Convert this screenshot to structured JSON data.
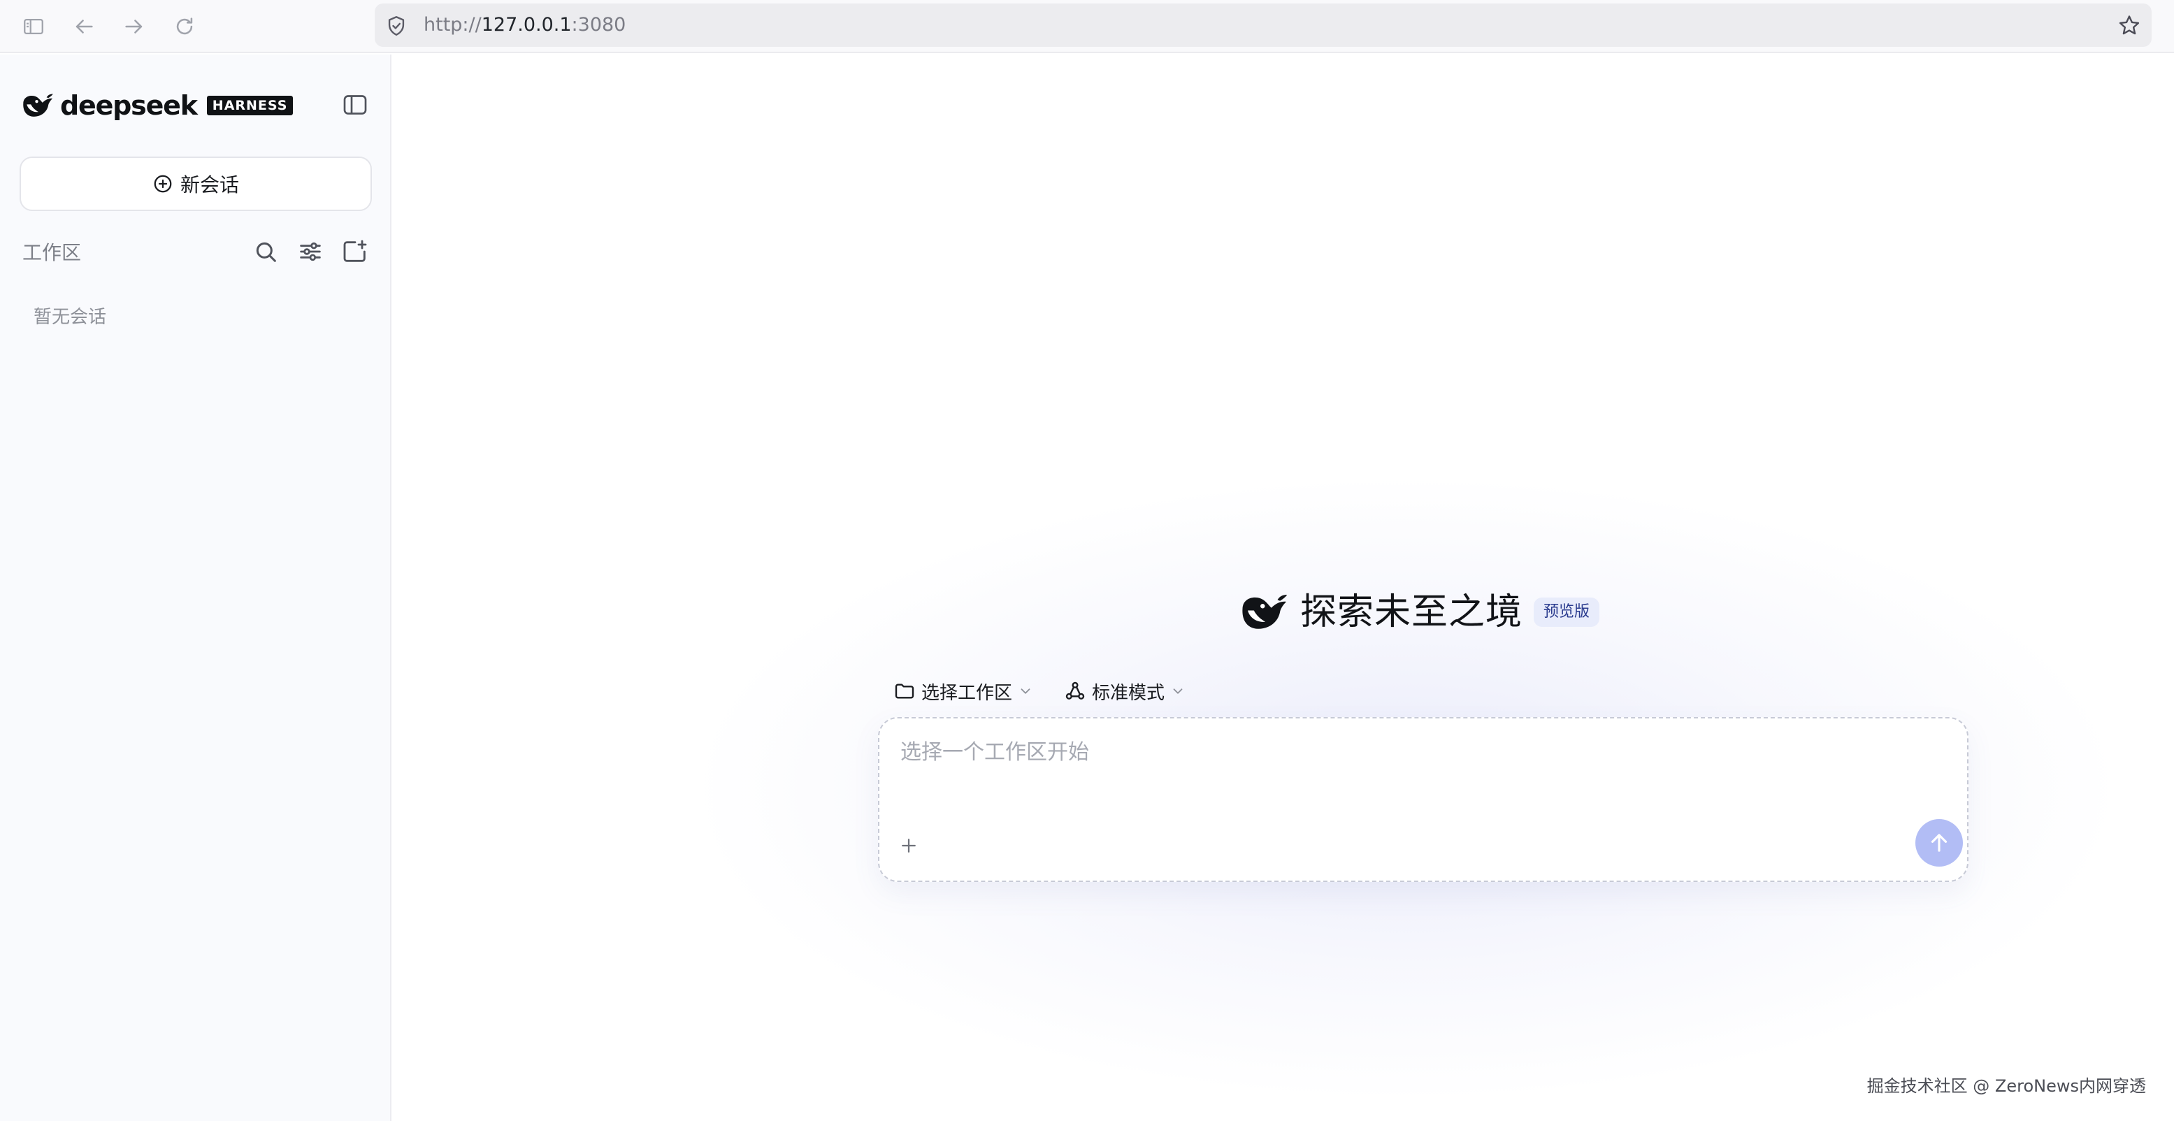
{
  "browser": {
    "url_scheme": "http://",
    "url_host": "127.0.0.1",
    "url_port": ":3080"
  },
  "sidebar": {
    "brand_name": "deepseek",
    "brand_badge": "HARNESS",
    "new_chat_label": "新会话",
    "workspace_label": "工作区",
    "empty_text": "暂无会话"
  },
  "main": {
    "hero_title": "探索未至之境",
    "hero_badge": "预览版",
    "workspace_selector_label": "选择工作区",
    "mode_selector_label": "标准模式",
    "composer_placeholder": "选择一个工作区开始"
  },
  "watermark": "掘金技术社区 @ ZeroNews内网穿透",
  "colors": {
    "accent": "#b2bdf5",
    "badge_bg": "#e8ecfb",
    "badge_text": "#2b3c8f",
    "sidebar_bg": "#f9fafd"
  },
  "icons": {
    "browser": [
      "sidebar-panel-icon",
      "back-arrow-icon",
      "forward-arrow-icon",
      "reload-icon",
      "shield-icon",
      "star-icon"
    ],
    "sidebar": [
      "deepseek-whale-icon",
      "sidebar-toggle-icon",
      "plus-circle-icon",
      "search-icon",
      "sliders-icon",
      "new-folder-icon"
    ],
    "main": [
      "deepseek-whale-icon",
      "folder-icon",
      "mode-icon",
      "chevron-down-icon",
      "plus-icon",
      "arrow-up-icon"
    ]
  }
}
